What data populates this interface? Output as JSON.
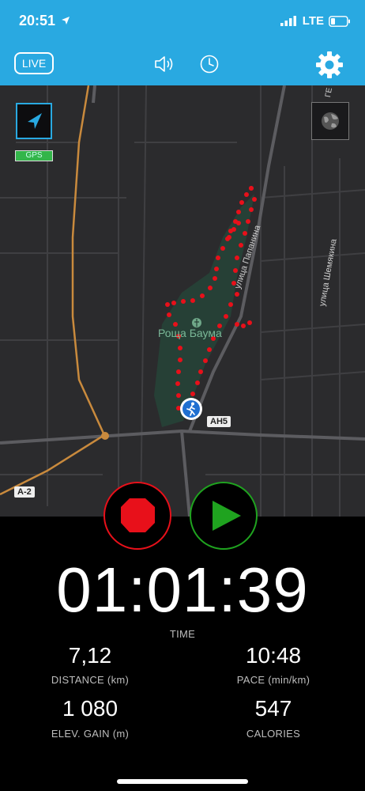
{
  "status_bar": {
    "time": "20:51",
    "network": "LTE"
  },
  "top_bar": {
    "live_label": "LIVE"
  },
  "map": {
    "gps_label": "GPS",
    "park_label": "Роща Баума",
    "street_1": "улица Папанина",
    "street_2": "улица Шемякина",
    "street_3": "ГЕ",
    "road_ah5": "AH5",
    "road_a2": "A-2"
  },
  "stats": {
    "timer": "01:01:39",
    "time_label": "TIME",
    "distance_value": "7,12",
    "distance_label": "DISTANCE (km)",
    "pace_value": "10:48",
    "pace_label": "PACE (min/km)",
    "elev_value": "1 080",
    "elev_label": "ELEV. GAIN (m)",
    "calories_value": "547",
    "calories_label": "CALORIES"
  },
  "colors": {
    "accent": "#29a9e1",
    "track": "#e8101a",
    "stop": "#e8101a",
    "play": "#1fa31f"
  }
}
